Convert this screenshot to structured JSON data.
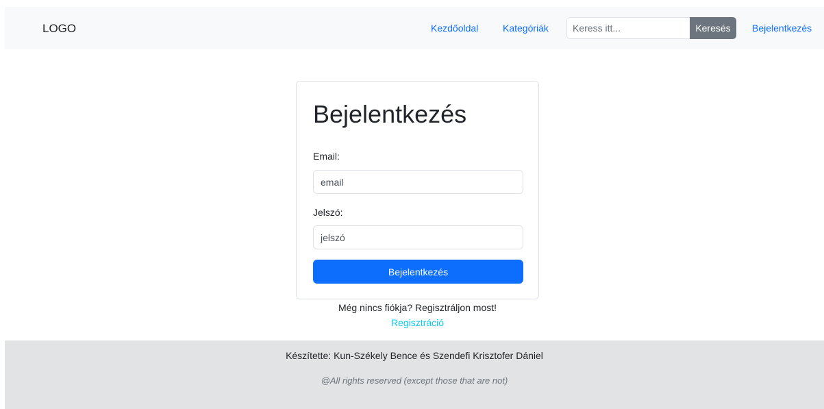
{
  "navbar": {
    "logo": "LOGO",
    "links": {
      "home": "Kezdőoldal",
      "categories": "Kategóriák",
      "login": "Bejelentkezés"
    },
    "search": {
      "placeholder": "Keress itt...",
      "button_label": "Keresés"
    }
  },
  "login": {
    "title": "Bejelentkezés",
    "email_label": "Email:",
    "email_placeholder": "email",
    "password_label": "Jelszó:",
    "password_placeholder": "jelszó",
    "submit_label": "Bejelentkezés",
    "register_prompt": "Még nincs fiókja? Regisztráljon most!",
    "register_link": "Regisztráció"
  },
  "footer": {
    "credit": "Készítette: Kun-Székely Bence és Szendefi Krisztofer Dániel",
    "rights": "@All rights reserved (except those that are not)"
  },
  "colors": {
    "primary": "#0d6efd",
    "secondary": "#6c757d",
    "info": "#0dcaf0",
    "navbar_bg": "#f8f9fa",
    "footer_bg": "#e2e3e5"
  }
}
